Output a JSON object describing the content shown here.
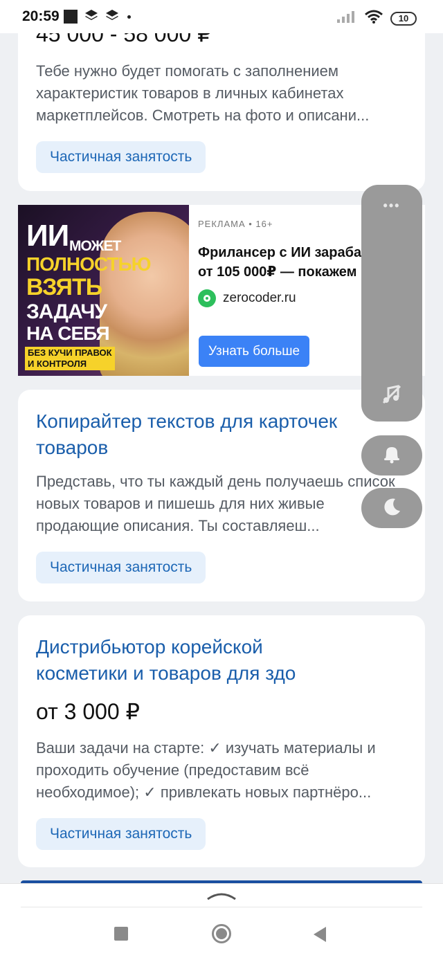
{
  "status_bar": {
    "time": "20:59",
    "battery": "10"
  },
  "card1": {
    "salary": "45 000 - 58 000 ₽",
    "description": "Тебе нужно будет помогать с заполнением характеристик товаров в личных кабинетах маркетплейсов. Смотреть на фото и описани...",
    "tag": "Частичная занятость"
  },
  "ad": {
    "image_lines": [
      "ИИ",
      "МОЖЕТ",
      "ПОЛНОСТЬЮ",
      "ВЗЯТЬ",
      "ЗАДАЧУ",
      "НА СЕБЯ"
    ],
    "image_badge": [
      "БЕЗ КУЧИ ПРАВОК",
      "И КОНТРОЛЯ"
    ],
    "meta": "РЕКЛАМА • 16+",
    "title_line1": "Фрилансер с ИИ зараба",
    "title_line2": "от 105 000₽ — покажем",
    "site": "zerocoder.ru",
    "button": "Узнать больше"
  },
  "card2": {
    "title_line1": "Копирайтер текстов для карточек",
    "title_line2": "товаров",
    "description": "Представь, что ты каждый день получаешь список новых товаров и пишешь для них живые продающие описания. Ты составляеш...",
    "tag": "Частичная занятость"
  },
  "card3": {
    "title_line1": "Дистрибьютор корейской",
    "title_line2": "косметики и товаров для здо",
    "salary": "от 3 000 ₽",
    "description": "Ваши задачи на старте: ✓ изучать материалы и проходить обучение (предоставим всё необходимое); ✓ привлекать новых партнёро...",
    "tag": "Частичная занятость"
  },
  "floating_panel": {
    "more": "•••"
  }
}
